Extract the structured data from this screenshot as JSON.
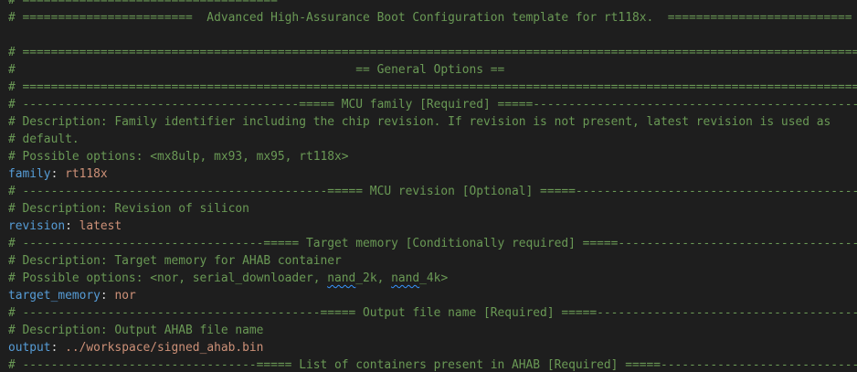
{
  "editor": {
    "lines": {
      "l0": "# ====================================",
      "l1": "# ========================  Advanced High-Assurance Boot Configuration template for rt118x.  ==========================",
      "l2": "",
      "l3": "# ======================================================================================================================",
      "l4": "#                                                == General Options ==",
      "l5": "# ======================================================================================================================",
      "l6": "# ---------------------------------------===== MCU family [Required] =====----------------------------------------------",
      "l7": "# Description: Family identifier including the chip revision. If revision is not present, latest revision is used as",
      "l8": "# default.",
      "l9": "# Possible options: <mx8ulp, mx93, mx95, rt118x>",
      "l10": {
        "key": "family",
        "sep": ": ",
        "value": "rt118x"
      },
      "l11": "# -------------------------------------------===== MCU revision [Optional] =====-------------------------------------------",
      "l12": "# Description: Revision of silicon",
      "l13": {
        "key": "revision",
        "sep": ": ",
        "value": "latest"
      },
      "l14": "# ----------------------------------===== Target memory [Conditionally required] =====------------------------------------",
      "l15": "# Description: Target memory for AHAB container",
      "l16": {
        "prefix": "# Possible options: <nor, serial_downloader, ",
        "squiggle1": "nand",
        "mid1": "_2k, ",
        "squiggle2": "nand",
        "suffix": "_4k>"
      },
      "l17": {
        "key": "target_memory",
        "sep": ": ",
        "value": "nor"
      },
      "l18": "# ------------------------------------------===== Output file name [Required] =====----------------------------------------",
      "l19": "# Description: Output AHAB file name",
      "l20": {
        "key": "output",
        "sep": ": ",
        "value": "../workspace/signed_ahab.bin"
      },
      "l21": "# ---------------------------------===== List of containers present in AHAB [Required] =====-------------------------------"
    }
  },
  "colors": {
    "background": "#1e1e1e",
    "comment": "#6a9955",
    "key": "#569cd6",
    "value": "#ce9178",
    "punctuation": "#d4d4d4",
    "squiggle": "#3794ff"
  }
}
